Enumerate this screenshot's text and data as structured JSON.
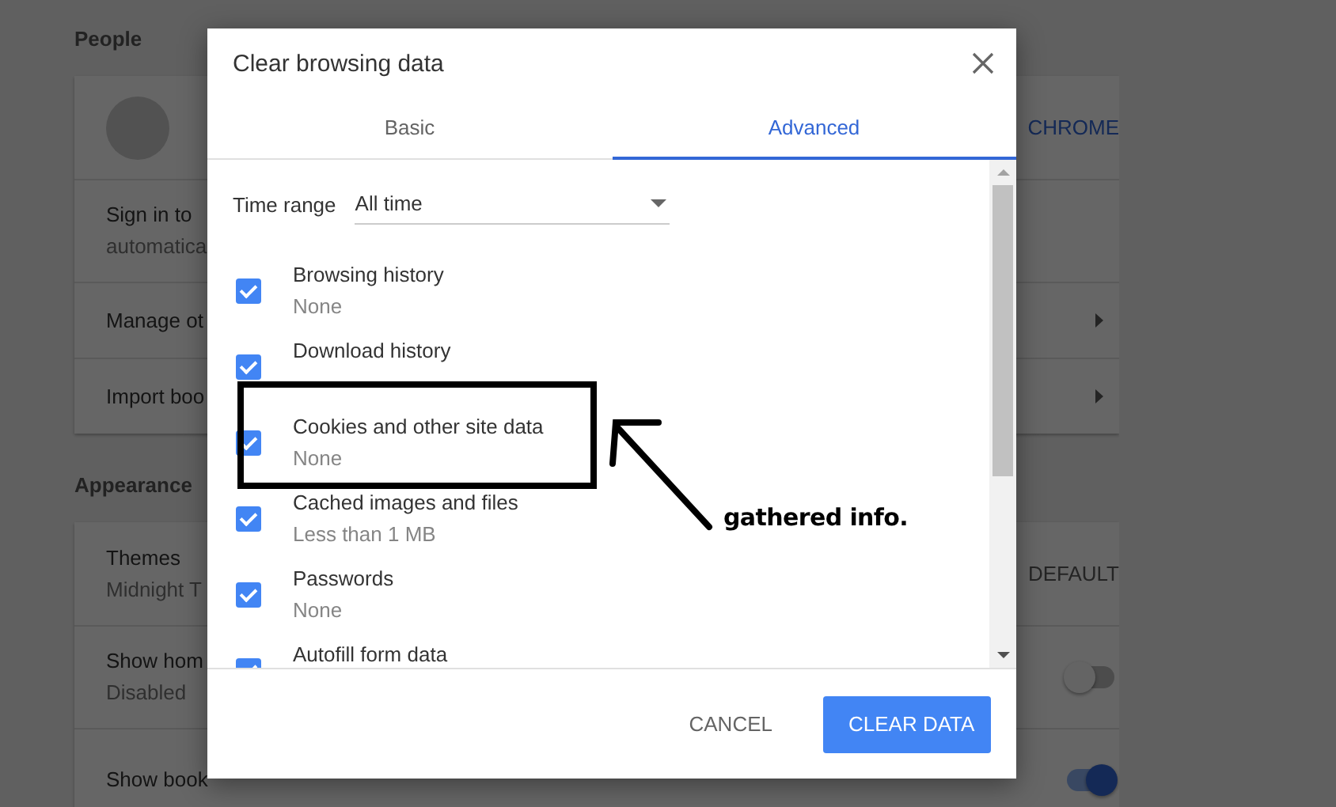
{
  "settings": {
    "sections": [
      {
        "heading": "People",
        "rows": [
          {
            "kind": "account",
            "action": "CHROME"
          },
          {
            "kind": "text",
            "lines": [
              "Sign in to",
              "automatica"
            ]
          },
          {
            "kind": "link",
            "lines": [
              "Manage ot"
            ]
          },
          {
            "kind": "link",
            "lines": [
              "Import boo"
            ]
          }
        ]
      },
      {
        "heading": "Appearance",
        "rows": [
          {
            "kind": "text",
            "lines": [
              "Themes",
              "Midnight T"
            ],
            "action": "DEFAULT"
          },
          {
            "kind": "toggle",
            "lines": [
              "Show hom",
              "Disabled"
            ],
            "on": false
          },
          {
            "kind": "toggle",
            "lines": [
              "Show book"
            ],
            "on": true
          }
        ]
      }
    ]
  },
  "dialog": {
    "title": "Clear browsing data",
    "tabs": [
      {
        "label": "Basic",
        "selected": false
      },
      {
        "label": "Advanced",
        "selected": true
      }
    ],
    "time_range": {
      "label": "Time range",
      "value": "All time"
    },
    "items": [
      {
        "label": "Browsing history",
        "detail": "None",
        "checked": true
      },
      {
        "label": "Download history",
        "checked": true
      },
      {
        "label": "Cookies and other site data",
        "detail": "None",
        "checked": true
      },
      {
        "label": "Cached images and files",
        "detail": "Less than 1 MB",
        "checked": true
      },
      {
        "label": "Passwords",
        "detail": "None",
        "checked": true
      },
      {
        "label": "Autofill form data",
        "checked": true
      }
    ],
    "buttons": [
      {
        "label": "CANCEL",
        "kind": "text"
      },
      {
        "label": "CLEAR DATA",
        "kind": "primary"
      }
    ]
  },
  "annotation": {
    "text": "gathered info."
  }
}
